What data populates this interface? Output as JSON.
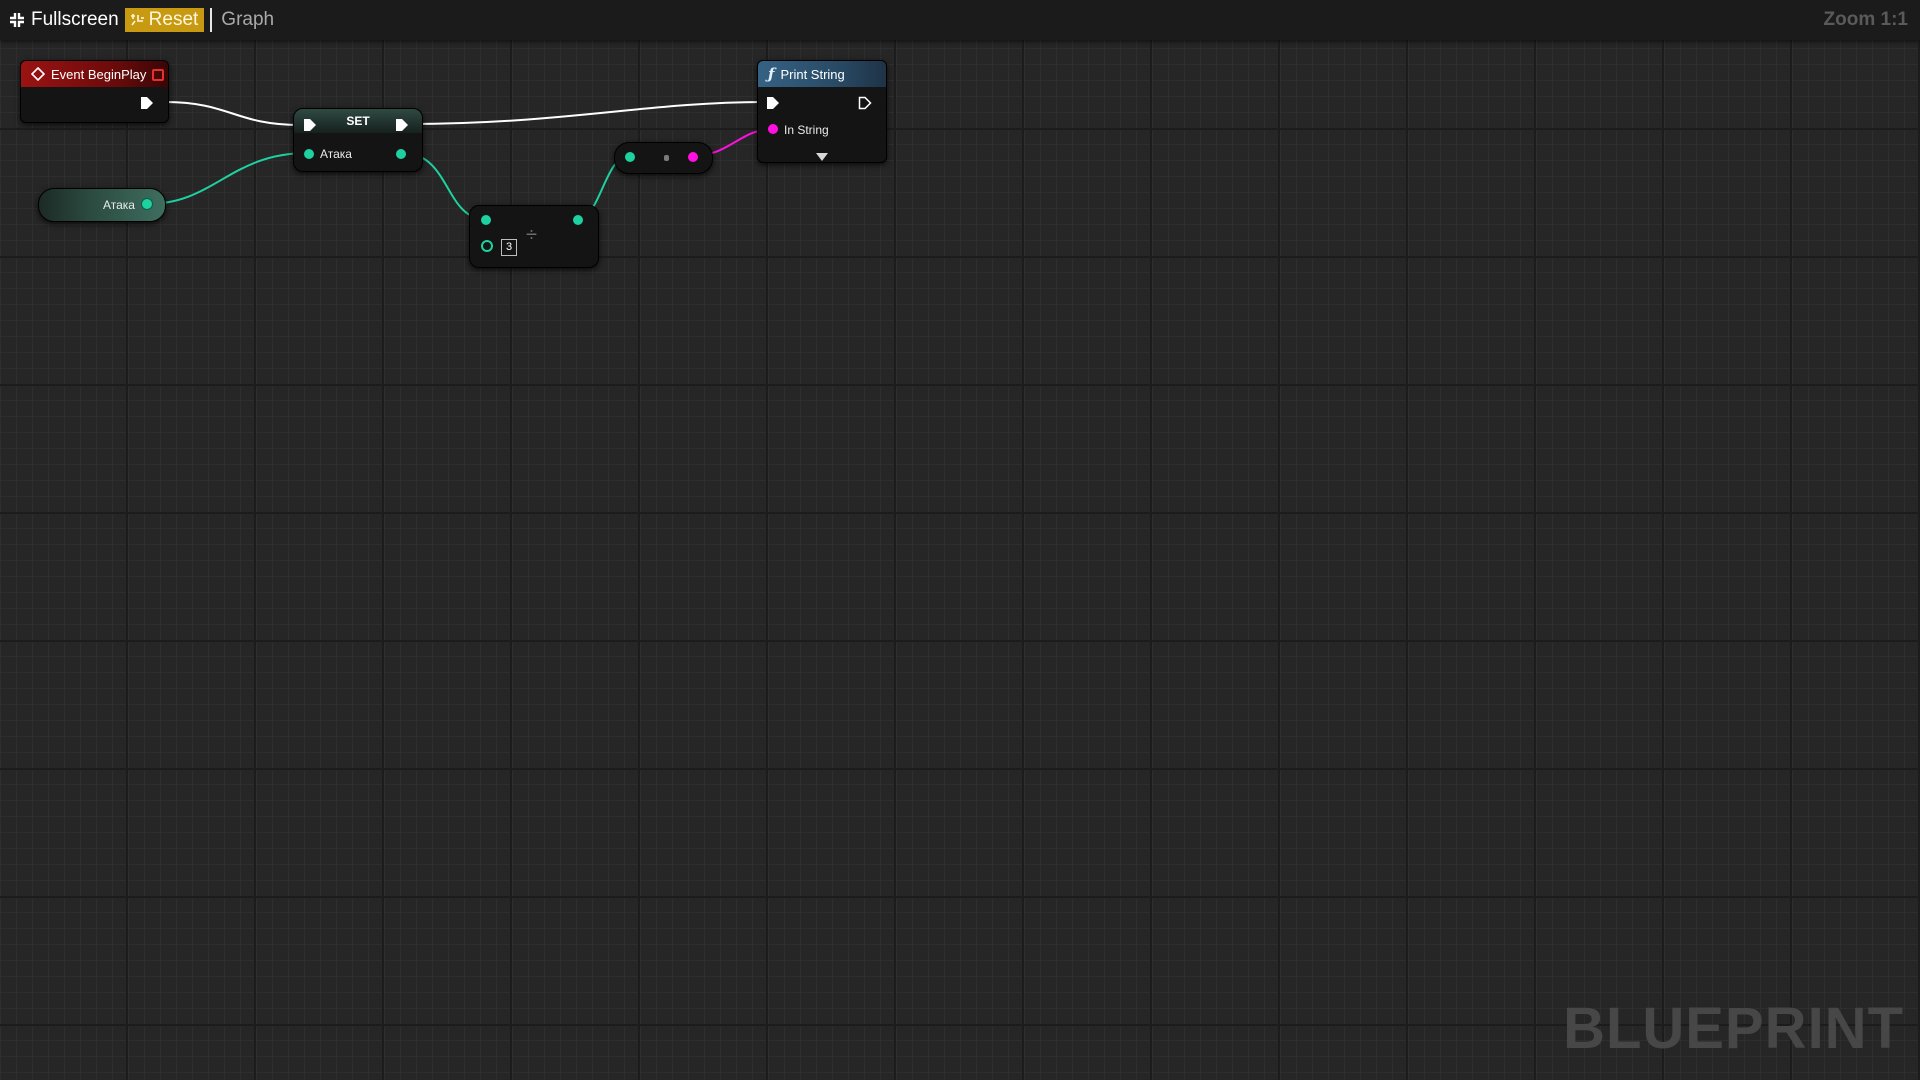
{
  "toolbar": {
    "fullscreen_label": "Fullscreen",
    "reset_label": "Reset",
    "graph_label": "Graph",
    "zoom_label": "Zoom 1:1"
  },
  "watermark": "BLUEPRINT",
  "nodes": {
    "event_begin_play": {
      "title": "Event BeginPlay",
      "icon": "event-diamond-icon",
      "color": "#9b1313"
    },
    "variable_get": {
      "label": "Атака",
      "pin_color": "#1ed1a0"
    },
    "set": {
      "title": "SET",
      "input_label": "Атака"
    },
    "divide": {
      "operator": "÷",
      "b_value": "3"
    },
    "conversion": {
      "icon": "conversion-dot-icon"
    },
    "print_string": {
      "title": "Print String",
      "icon": "function-icon",
      "input_label": "In String",
      "color": "#356284"
    }
  },
  "colors": {
    "exec_wire": "#ffffff",
    "float_wire": "#1ed1a0",
    "string_wire": "#ff10e0",
    "reset_button": "#c89a12"
  }
}
